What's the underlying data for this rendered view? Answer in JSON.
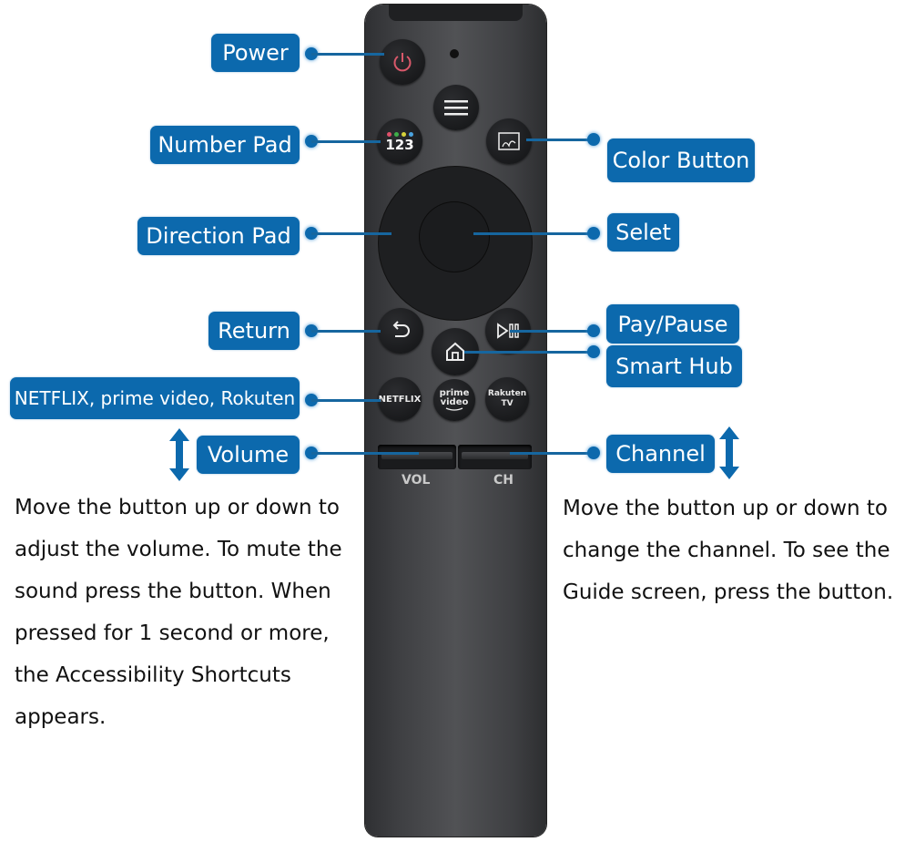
{
  "labels": {
    "power": "Power",
    "number_pad": "Number Pad",
    "direction_pad": "Direction Pad",
    "return": "Return",
    "streaming": "NETFLIX, prime video, Rokuten",
    "volume": "Volume",
    "color_button": "Color Button",
    "select": "Selet",
    "play_pause": "Pay/Pause",
    "smart_hub": "Smart Hub",
    "channel": "Channel"
  },
  "remote": {
    "number_button_text": "123",
    "number_dots": [
      "#e0506a",
      "#3fae49",
      "#d7d23a",
      "#4aa3e0"
    ],
    "netflix_text": "NETFLIX",
    "prime_text_1": "prime",
    "prime_text_2": "video",
    "rakuten_text_1": "Rakuten",
    "rakuten_text_2": "TV",
    "vol_label": "VOL",
    "ch_label": "CH"
  },
  "descriptions": {
    "volume": "Move the button up or down to\nadjust the volume. To mute the\nsound press the button. When\npressed for 1 second or more,\nthe Accessibility Shortcuts\nappears.",
    "channel": "Move the button up or down to\nchange the channel. To see the\nGuide screen, press the button."
  },
  "colors": {
    "label_bg": "#0c69ad",
    "power_icon": "#d9586a"
  }
}
